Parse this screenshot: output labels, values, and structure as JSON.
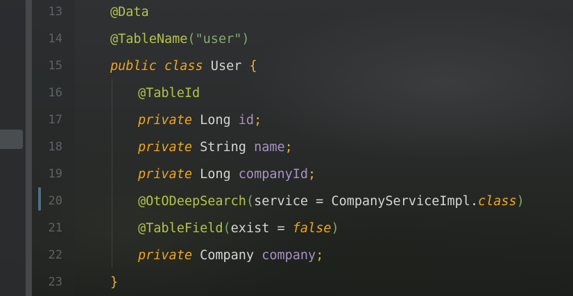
{
  "editor": {
    "lines": [
      {
        "num": "13",
        "indent": 0,
        "tokens": [
          {
            "t": "@Data",
            "c": "anno"
          }
        ]
      },
      {
        "num": "14",
        "indent": 0,
        "tokens": [
          {
            "t": "@TableName",
            "c": "anno"
          },
          {
            "t": "(",
            "c": "paren"
          },
          {
            "t": "\"user\"",
            "c": "str"
          },
          {
            "t": ")",
            "c": "paren"
          }
        ]
      },
      {
        "num": "15",
        "indent": 0,
        "tokens": [
          {
            "t": "public",
            "c": "kw"
          },
          {
            "t": " ",
            "c": "plain"
          },
          {
            "t": "class",
            "c": "kw"
          },
          {
            "t": " User ",
            "c": "plain"
          },
          {
            "t": "{",
            "c": "brace"
          }
        ]
      },
      {
        "num": "16",
        "indent": 1,
        "tokens": [
          {
            "t": "@TableId",
            "c": "anno"
          }
        ]
      },
      {
        "num": "17",
        "indent": 1,
        "tokens": [
          {
            "t": "private",
            "c": "kw"
          },
          {
            "t": " Long ",
            "c": "plain"
          },
          {
            "t": "id",
            "c": "field"
          },
          {
            "t": ";",
            "c": "brace"
          }
        ]
      },
      {
        "num": "18",
        "indent": 1,
        "tokens": [
          {
            "t": "private",
            "c": "kw"
          },
          {
            "t": " String ",
            "c": "plain"
          },
          {
            "t": "name",
            "c": "field"
          },
          {
            "t": ";",
            "c": "brace"
          }
        ]
      },
      {
        "num": "19",
        "indent": 1,
        "tokens": [
          {
            "t": "private",
            "c": "kw"
          },
          {
            "t": " Long ",
            "c": "plain"
          },
          {
            "t": "companyId",
            "c": "field"
          },
          {
            "t": ";",
            "c": "brace"
          }
        ]
      },
      {
        "num": "20",
        "indent": 1,
        "tokens": [
          {
            "t": "@OtODeepSearch",
            "c": "anno"
          },
          {
            "t": "(",
            "c": "paren"
          },
          {
            "t": "service = CompanyServiceImpl.",
            "c": "plain"
          },
          {
            "t": "class",
            "c": "kw"
          },
          {
            "t": ")",
            "c": "paren"
          }
        ]
      },
      {
        "num": "21",
        "indent": 1,
        "tokens": [
          {
            "t": "@TableField",
            "c": "anno"
          },
          {
            "t": "(",
            "c": "paren"
          },
          {
            "t": "exist = ",
            "c": "plain"
          },
          {
            "t": "false",
            "c": "kw"
          },
          {
            "t": ")",
            "c": "paren"
          }
        ]
      },
      {
        "num": "22",
        "indent": 1,
        "tokens": [
          {
            "t": "private",
            "c": "kw"
          },
          {
            "t": " Company ",
            "c": "plain"
          },
          {
            "t": "company",
            "c": "field"
          },
          {
            "t": ";",
            "c": "brace"
          }
        ]
      },
      {
        "num": "23",
        "indent": 0,
        "tokens": [
          {
            "t": "}",
            "c": "brace"
          }
        ]
      }
    ],
    "colors": {
      "annotation": "#b4c447",
      "string": "#89a871",
      "keyword": "#f3a712",
      "field": "#a892c4",
      "brace": "#e7b530",
      "paren": "#7fae57",
      "text": "#d6d6d2",
      "line_number": "#5f6265"
    }
  }
}
